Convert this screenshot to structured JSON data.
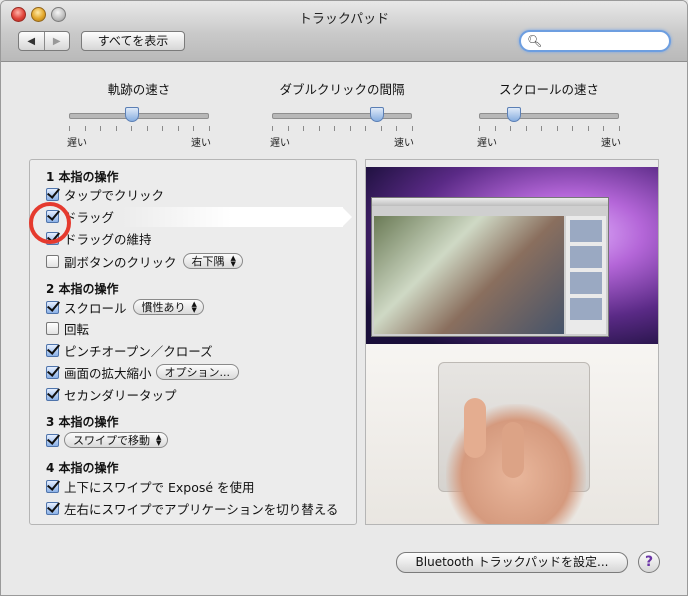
{
  "window": {
    "title": "トラックパッド",
    "show_all_label": "すべてを表示",
    "nav_back": "◀",
    "nav_forward": "▶",
    "search_placeholder": ""
  },
  "sliders": [
    {
      "title": "軌跡の速さ",
      "min_label": "遅い",
      "max_label": "速い",
      "value_fraction": 0.45
    },
    {
      "title": "ダブルクリックの間隔",
      "min_label": "遅い",
      "max_label": "速い",
      "value_fraction": 0.75
    },
    {
      "title": "スクロールの速さ",
      "min_label": "遅い",
      "max_label": "速い",
      "value_fraction": 0.25
    }
  ],
  "sections": {
    "one_finger": {
      "title": "1 本指の操作",
      "tap_to_click": {
        "label": "タップでクリック",
        "checked": true
      },
      "drag": {
        "label": "ドラッグ",
        "checked": true
      },
      "drag_lock": {
        "label": "ドラッグの維持",
        "checked": true
      },
      "secondary_click": {
        "label": "副ボタンのクリック",
        "checked": false,
        "popup": "右下隅"
      }
    },
    "two_finger": {
      "title": "2 本指の操作",
      "scroll": {
        "label": "スクロール",
        "checked": true,
        "popup": "慣性あり"
      },
      "rotate": {
        "label": "回転",
        "checked": false
      },
      "pinch": {
        "label": "ピンチオープン／クローズ",
        "checked": true
      },
      "zoom": {
        "label": "画面の拡大縮小",
        "checked": true,
        "button": "オプション..."
      },
      "secondary_tap": {
        "label": "セカンダリータップ",
        "checked": true
      }
    },
    "three_finger": {
      "title": "3 本指の操作",
      "swipe": {
        "checked": true,
        "popup": "スワイプで移動"
      }
    },
    "four_finger": {
      "title": "4 本指の操作",
      "expose": {
        "label": "上下にスワイプで Exposé を使用",
        "checked": true
      },
      "app_switch": {
        "label": "左右にスワイプでアプリケーションを切り替える",
        "checked": true
      }
    }
  },
  "footer": {
    "bluetooth_button": "Bluetooth トラックパッドを設定...",
    "help": "?"
  },
  "colors": {
    "highlight_circle": "#e53a2e",
    "checkbox_on": "#8cb2e8"
  }
}
